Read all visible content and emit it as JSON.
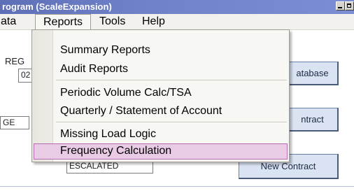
{
  "window": {
    "title": "rogram (ScaleExpansion)"
  },
  "menubar": {
    "items": [
      {
        "label": "ata"
      },
      {
        "label": "Reports"
      },
      {
        "label": "Tools"
      },
      {
        "label": "Help"
      }
    ]
  },
  "reports_menu": {
    "items": [
      {
        "label": "Summary Reports"
      },
      {
        "label": "Audit Reports"
      },
      {
        "label": "Periodic Volume Calc/TSA"
      },
      {
        "label": "Quarterly / Statement of Account"
      },
      {
        "label": "Missing Load Logic"
      },
      {
        "label": "Frequency Calculation",
        "highlighted": true
      }
    ],
    "highlight_color": "#e9cbe6"
  },
  "background": {
    "reg_label": "REG",
    "reg_value": "02",
    "left_field_value": "GE",
    "escalated_value": "ESCALATED",
    "database_button": "atabase",
    "contract_button": "ntract",
    "new_contract_button": "New Contract"
  }
}
